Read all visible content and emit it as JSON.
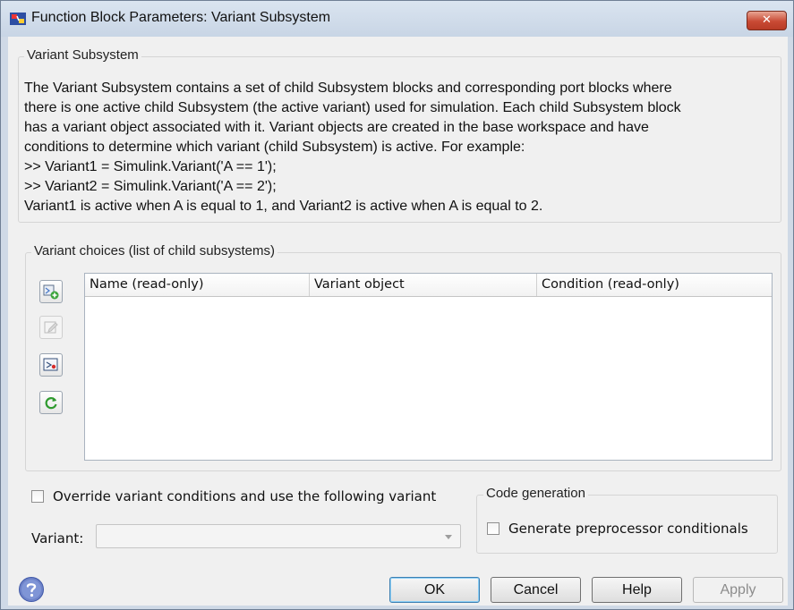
{
  "window": {
    "title": "Function Block Parameters: Variant Subsystem",
    "close_symbol": "✕"
  },
  "header_group": {
    "legend": "Variant Subsystem",
    "description_lines": [
      "The Variant Subsystem contains a set of child Subsystem blocks and corresponding port blocks where",
      "there is one active child Subsystem (the active variant) used for simulation. Each child Subsystem block",
      "has a variant object associated with it. Variant objects are created in the base workspace and have",
      "conditions to determine which variant (child Subsystem) is active. For example:",
      ">> Variant1 = Simulink.Variant('A == 1');",
      ">> Variant2 = Simulink.Variant('A == 2');",
      "Variant1 is active when A is equal to 1, and Variant2 is active when A is equal to 2."
    ]
  },
  "choices_group": {
    "legend": "Variant choices (list of child subsystems)",
    "tools": [
      {
        "icon": "add-choice-icon"
      },
      {
        "icon": "edit-choice-icon",
        "disabled": true
      },
      {
        "icon": "open-block-icon"
      },
      {
        "icon": "refresh-icon"
      }
    ],
    "table": {
      "columns": [
        "Name (read-only)",
        "Variant object",
        "Condition (read-only)"
      ],
      "rows": []
    }
  },
  "override": {
    "checkbox_label": "Override variant conditions and use the following variant",
    "checked": false,
    "variant_label": "Variant:",
    "variant_value": ""
  },
  "code_generation": {
    "legend": "Code generation",
    "checkbox_label": "Generate preprocessor conditionals",
    "checked": false
  },
  "buttons": {
    "ok": "OK",
    "cancel": "Cancel",
    "help": "Help",
    "apply": "Apply"
  },
  "colors": {
    "title_bar": "#cfd9e6",
    "dialog_bg": "#f0f0f0",
    "close_button": "#c94a34",
    "default_button_border": "#3c7fb1"
  }
}
